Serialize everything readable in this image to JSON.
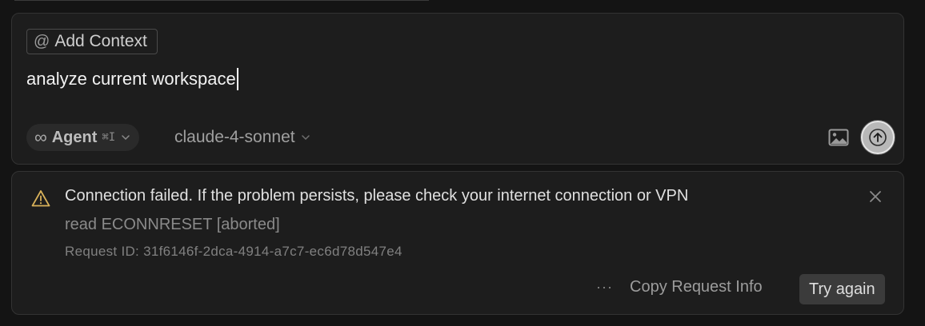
{
  "composer": {
    "add_context_label": "Add Context",
    "add_context_icon": "at-icon",
    "prompt_value": "analyze current workspace",
    "mode": {
      "icon": "infinity-icon",
      "label": "Agent",
      "shortcut": "⌘I"
    },
    "model": "claude-4-sonnet",
    "image_icon": "image-icon",
    "send_icon": "arrow-up-icon"
  },
  "error": {
    "icon": "warning-icon",
    "title": "Connection failed. If the problem persists, please check your internet connection or VPN",
    "detail": "read ECONNRESET [aborted]",
    "request_id": "Request ID: 31f6146f-2dca-4914-a7c7-ec6d78d547e4",
    "more_label": "···",
    "copy_label": "Copy Request Info",
    "retry_label": "Try again",
    "close_icon": "close-icon"
  }
}
